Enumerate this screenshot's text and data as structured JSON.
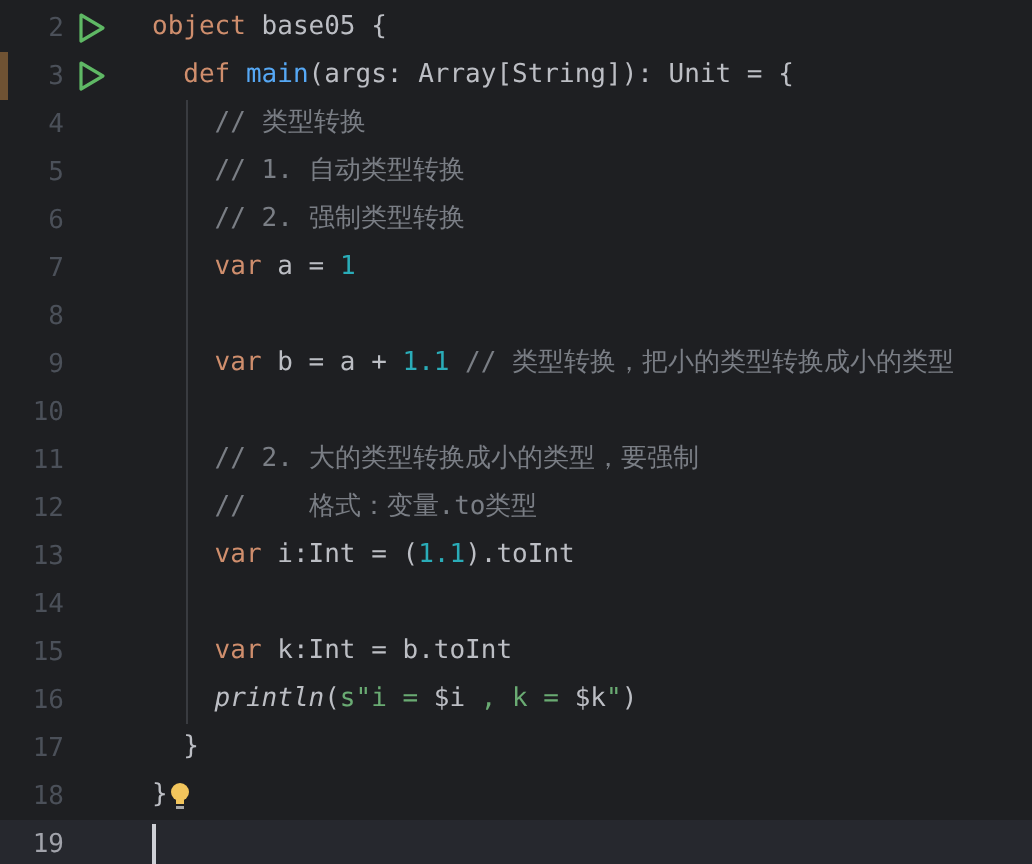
{
  "editor": {
    "lines": [
      {
        "number": "2",
        "run": true,
        "modified": false,
        "current": false,
        "bulb": false,
        "tokens": [
          {
            "kind": "kw",
            "text": "object "
          },
          {
            "kind": "plain",
            "text": "base05 {"
          }
        ]
      },
      {
        "number": "3",
        "run": true,
        "modified": true,
        "current": false,
        "bulb": false,
        "tokens": [
          {
            "kind": "kw",
            "text": "  def "
          },
          {
            "kind": "fn",
            "text": "main"
          },
          {
            "kind": "plain",
            "text": "(args: Array[String]): Unit = {"
          }
        ]
      },
      {
        "number": "4",
        "run": false,
        "modified": false,
        "current": false,
        "bulb": false,
        "tokens": [
          {
            "kind": "comment",
            "text": "    // 类型转换"
          }
        ]
      },
      {
        "number": "5",
        "run": false,
        "modified": false,
        "current": false,
        "bulb": false,
        "tokens": [
          {
            "kind": "comment",
            "text": "    // 1. 自动类型转换"
          }
        ]
      },
      {
        "number": "6",
        "run": false,
        "modified": false,
        "current": false,
        "bulb": false,
        "tokens": [
          {
            "kind": "comment",
            "text": "    // 2. 强制类型转换"
          }
        ]
      },
      {
        "number": "7",
        "run": false,
        "modified": false,
        "current": false,
        "bulb": false,
        "tokens": [
          {
            "kind": "kw",
            "text": "    var "
          },
          {
            "kind": "plain",
            "text": "a = "
          },
          {
            "kind": "num",
            "text": "1"
          }
        ]
      },
      {
        "number": "8",
        "run": false,
        "modified": false,
        "current": false,
        "bulb": false
      },
      {
        "number": "9",
        "run": false,
        "modified": false,
        "current": false,
        "bulb": false,
        "tokens": [
          {
            "kind": "kw",
            "text": "    var "
          },
          {
            "kind": "plain",
            "text": "b = a + "
          },
          {
            "kind": "num",
            "text": "1.1"
          },
          {
            "kind": "comment",
            "text": " // 类型转换，把小的类型转换成小的类型"
          }
        ]
      },
      {
        "number": "10",
        "run": false,
        "modified": false,
        "current": false,
        "bulb": false
      },
      {
        "number": "11",
        "run": false,
        "modified": false,
        "current": false,
        "bulb": false,
        "tokens": [
          {
            "kind": "comment",
            "text": "    // 2. 大的类型转换成小的类型，要强制"
          }
        ]
      },
      {
        "number": "12",
        "run": false,
        "modified": false,
        "current": false,
        "bulb": false,
        "tokens": [
          {
            "kind": "comment",
            "text": "    //    格式：变量.to类型"
          }
        ]
      },
      {
        "number": "13",
        "run": false,
        "modified": false,
        "current": false,
        "bulb": false,
        "tokens": [
          {
            "kind": "kw",
            "text": "    var "
          },
          {
            "kind": "plain",
            "text": "i:Int = ("
          },
          {
            "kind": "num",
            "text": "1.1"
          },
          {
            "kind": "plain",
            "text": ").toInt"
          }
        ]
      },
      {
        "number": "14",
        "run": false,
        "modified": false,
        "current": false,
        "bulb": false
      },
      {
        "number": "15",
        "run": false,
        "modified": false,
        "current": false,
        "bulb": false,
        "tokens": [
          {
            "kind": "kw",
            "text": "    var "
          },
          {
            "kind": "plain",
            "text": "k:Int = b.toInt"
          }
        ]
      },
      {
        "number": "16",
        "run": false,
        "modified": false,
        "current": false,
        "bulb": false,
        "tokens": [
          {
            "kind": "call",
            "text": "    println"
          },
          {
            "kind": "plain",
            "text": "("
          },
          {
            "kind": "str",
            "text": "s\"i = "
          },
          {
            "kind": "plain",
            "text": "$i"
          },
          {
            "kind": "str",
            "text": " , k = "
          },
          {
            "kind": "plain",
            "text": "$k"
          },
          {
            "kind": "str",
            "text": "\""
          },
          {
            "kind": "plain",
            "text": ")"
          }
        ]
      },
      {
        "number": "17",
        "run": false,
        "modified": false,
        "current": false,
        "bulb": false,
        "tokens": [
          {
            "kind": "plain",
            "text": "  }"
          }
        ]
      },
      {
        "number": "18",
        "run": false,
        "modified": false,
        "current": false,
        "bulb": true,
        "tokens": [
          {
            "kind": "plain",
            "text": "}"
          }
        ]
      },
      {
        "number": "19",
        "run": false,
        "modified": false,
        "current": true,
        "bulb": false
      }
    ]
  }
}
